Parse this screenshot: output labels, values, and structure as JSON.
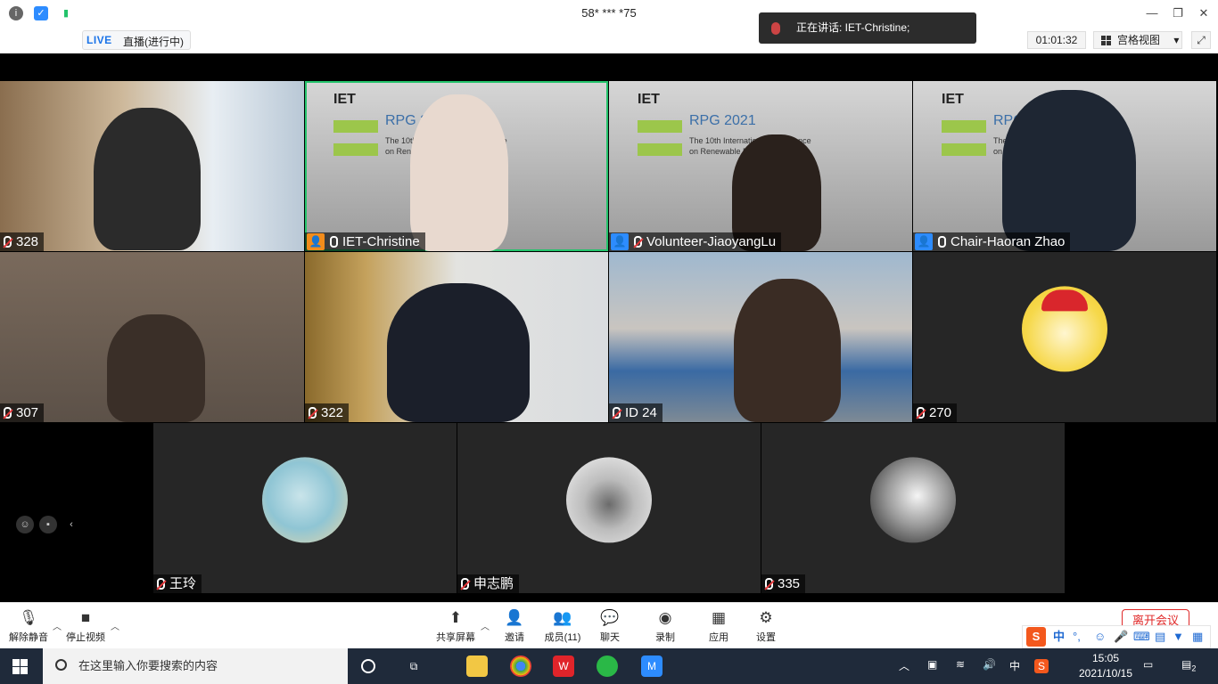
{
  "window": {
    "title": "58* *** *75"
  },
  "infobar": {
    "live_tag": "LIVE",
    "live_text": "直播(进行中)",
    "timer": "01:01:32",
    "view_label": "宫格视图",
    "view_caret": "▾"
  },
  "toast": {
    "text": "正在讲话: IET-Christine;"
  },
  "tiles": [
    {
      "name": "328"
    },
    {
      "name": "IET-Christine"
    },
    {
      "name": "Volunteer-JiaoyangLu"
    },
    {
      "name": "Chair-Haoran Zhao"
    },
    {
      "name": "307"
    },
    {
      "name": "322"
    },
    {
      "name": "ID 24"
    },
    {
      "name": "270"
    },
    {
      "name": "王玲"
    },
    {
      "name": "申志鹏"
    },
    {
      "name": "335"
    }
  ],
  "slide": {
    "logo": "IET",
    "event": "RPG 2021",
    "line1": "The 10th International Conference",
    "line2": "on Renewable Power Generation"
  },
  "toolbar": {
    "unmute": "解除静音",
    "stop_video": "停止视频",
    "share": "共享屏幕",
    "invite": "邀请",
    "members": "成员(11)",
    "chat": "聊天",
    "record": "录制",
    "apps": "应用",
    "settings": "设置",
    "leave": "离开会议"
  },
  "ime": {
    "lang": "中"
  },
  "taskbar": {
    "search_placeholder": "在这里输入你要搜索的内容",
    "tray_lang": "中",
    "time": "15:05",
    "date": "2021/10/15",
    "notif_count": "2"
  },
  "colors": {
    "active_speaker": "#23c36b",
    "host_badge": "#f28c1b",
    "cohost_badge": "#2d8cff",
    "leave": "#e02828",
    "live": "#1a73e8"
  }
}
